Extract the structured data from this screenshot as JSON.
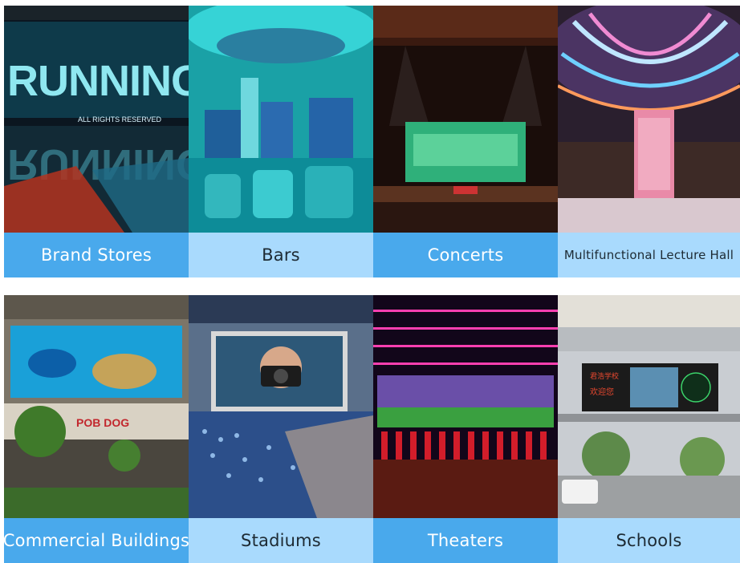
{
  "tiles": [
    {
      "name": "brand-stores",
      "label": "Brand Stores",
      "photo_text": "RUNNING",
      "photo_subtext": "ALL RIGHTS RESERVED"
    },
    {
      "name": "bars",
      "label": "Bars"
    },
    {
      "name": "concerts",
      "label": "Concerts"
    },
    {
      "name": "multifunctional-lecture-hall",
      "label": "Multifunctional Lecture Hall"
    },
    {
      "name": "commercial-buildings",
      "label": "Commercial Buildings",
      "sign_text": "POB DOG"
    },
    {
      "name": "stadiums",
      "label": "Stadiums"
    },
    {
      "name": "theaters",
      "label": "Theaters"
    },
    {
      "name": "schools",
      "label": "Schools",
      "screen_text_1": "君浩学校",
      "screen_text_2": "欢迎您"
    }
  ],
  "colors": {
    "label_dark": "#49a9ec",
    "label_light": "#a9dafd"
  }
}
